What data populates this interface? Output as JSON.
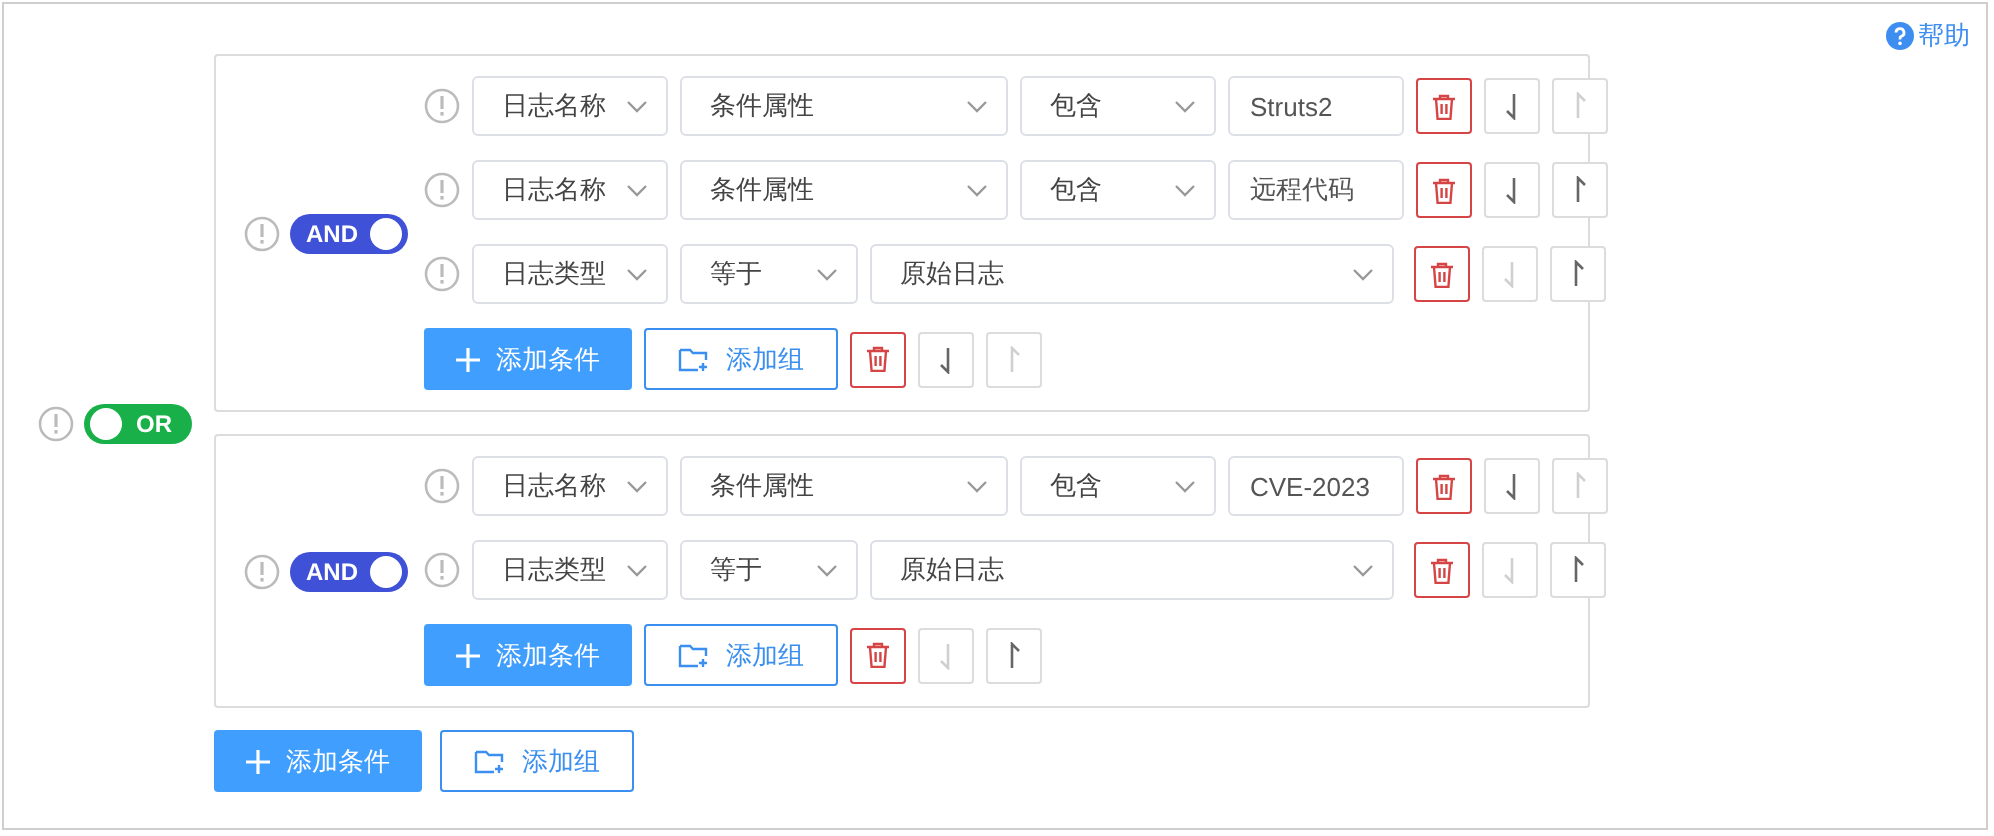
{
  "help": {
    "label": "帮助"
  },
  "root": {
    "logic": {
      "label": "OR",
      "on": false
    },
    "groups": [
      {
        "logic": {
          "label": "AND",
          "on": true
        },
        "rows": [
          {
            "kind": "text",
            "attribute": "日志名称",
            "property": "条件属性",
            "operator": "包含",
            "value": "Struts2",
            "move_down": {
              "disabled": false
            },
            "move_up": {
              "disabled": true
            }
          },
          {
            "kind": "text",
            "attribute": "日志名称",
            "property": "条件属性",
            "operator": "包含",
            "value": "远程代码",
            "move_down": {
              "disabled": false
            },
            "move_up": {
              "disabled": false
            }
          },
          {
            "kind": "enum",
            "attribute": "日志类型",
            "operator": "等于",
            "value": "原始日志",
            "move_down": {
              "disabled": true
            },
            "move_up": {
              "disabled": false
            }
          }
        ],
        "add_condition": "添加条件",
        "add_group": "添加组",
        "move_down": {
          "disabled": false
        },
        "move_up": {
          "disabled": true
        }
      },
      {
        "logic": {
          "label": "AND",
          "on": true
        },
        "rows": [
          {
            "kind": "text",
            "attribute": "日志名称",
            "property": "条件属性",
            "operator": "包含",
            "value": "CVE-2023",
            "move_down": {
              "disabled": false
            },
            "move_up": {
              "disabled": true
            }
          },
          {
            "kind": "enum",
            "attribute": "日志类型",
            "operator": "等于",
            "value": "原始日志",
            "move_down": {
              "disabled": true
            },
            "move_up": {
              "disabled": false
            }
          }
        ],
        "add_condition": "添加条件",
        "add_group": "添加组",
        "move_down": {
          "disabled": true
        },
        "move_up": {
          "disabled": false
        }
      }
    ],
    "add_condition": "添加条件",
    "add_group": "添加组"
  }
}
